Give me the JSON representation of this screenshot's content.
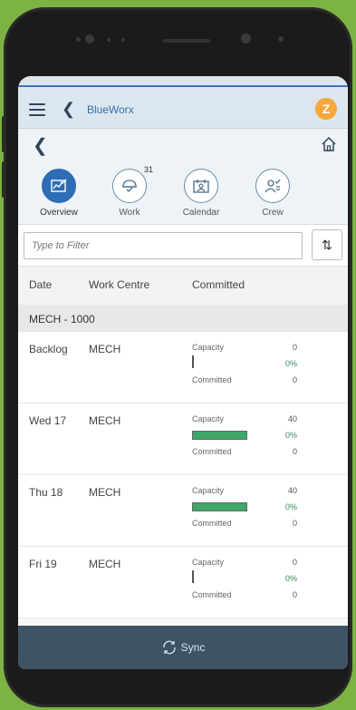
{
  "app": {
    "title": "BlueWorx",
    "avatar_letter": "Z"
  },
  "tabs": [
    {
      "label": "Overview",
      "icon": "chart-check-icon",
      "active": true
    },
    {
      "label": "Work",
      "icon": "hardhat-check-icon",
      "badge": "31"
    },
    {
      "label": "Calendar",
      "icon": "calendar-person-icon"
    },
    {
      "label": "Crew",
      "icon": "crew-icon"
    }
  ],
  "filter": {
    "placeholder": "Type to Filter"
  },
  "columns": {
    "date": "Date",
    "work_centre": "Work Centre",
    "committed": "Committed"
  },
  "group": {
    "label": "MECH - 1000"
  },
  "rows": [
    {
      "date": "Backlog",
      "work_centre": "MECH",
      "capacity_label": "Capacity",
      "capacity": "0",
      "percent": "0%",
      "committed_label": "Committed",
      "committed": "0",
      "fill": 0
    },
    {
      "date": "Wed 17",
      "work_centre": "MECH",
      "capacity_label": "Capacity",
      "capacity": "40",
      "percent": "0%",
      "committed_label": "Committed",
      "committed": "0",
      "fill": 1
    },
    {
      "date": "Thu 18",
      "work_centre": "MECH",
      "capacity_label": "Capacity",
      "capacity": "40",
      "percent": "0%",
      "committed_label": "Committed",
      "committed": "0",
      "fill": 1
    },
    {
      "date": "Fri 19",
      "work_centre": "MECH",
      "capacity_label": "Capacity",
      "capacity": "0",
      "percent": "0%",
      "committed_label": "Committed",
      "committed": "0",
      "fill": 0
    }
  ],
  "footer": {
    "sync_label": "Sync"
  },
  "colors": {
    "accent": "#2d6db5",
    "bar_fill": "#3ea769",
    "footer": "#3e5466",
    "background": "#7cb342"
  }
}
